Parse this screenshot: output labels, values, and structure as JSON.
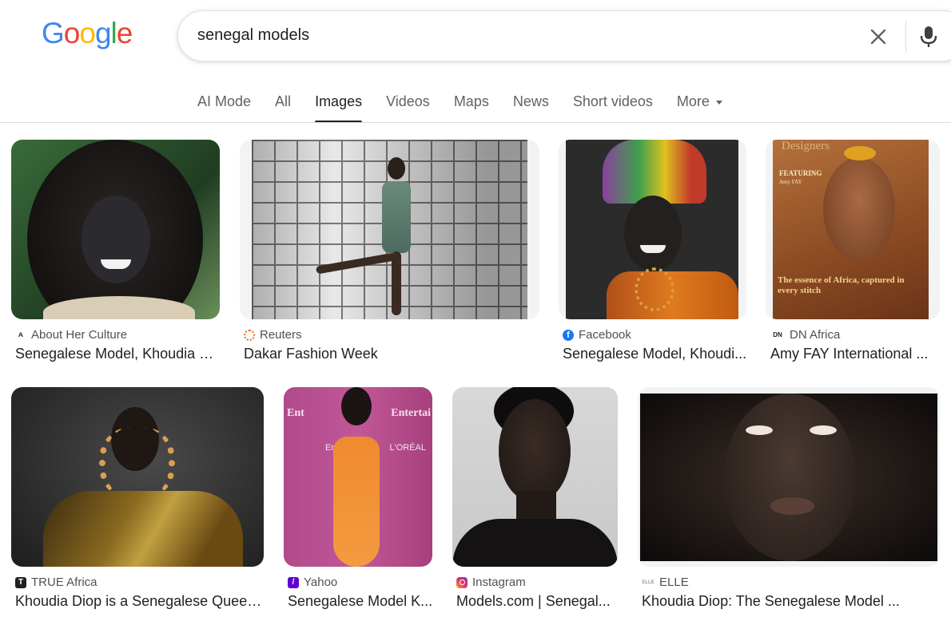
{
  "logo": {
    "text": "Google"
  },
  "search": {
    "query": "senegal models"
  },
  "tabs": [
    {
      "label": "AI Mode"
    },
    {
      "label": "All"
    },
    {
      "label": "Images"
    },
    {
      "label": "Videos"
    },
    {
      "label": "Maps"
    },
    {
      "label": "News"
    },
    {
      "label": "Short videos"
    },
    {
      "label": "More"
    }
  ],
  "results": [
    {
      "source": "About Her Culture",
      "title": "Senegalese Model, Khoudia D..."
    },
    {
      "source": "Reuters",
      "title": "Dakar Fashion Week"
    },
    {
      "source": "Facebook",
      "title": "Senegalese Model, Khoudi..."
    },
    {
      "source": "DN Africa",
      "title": "Amy FAY International ..."
    },
    {
      "source": "TRUE Africa",
      "title": "Khoudia Diop is a Senegalese Queen..."
    },
    {
      "source": "Yahoo",
      "title": "Senegalese Model K..."
    },
    {
      "source": "Instagram",
      "title": "Models.com | Senegal..."
    },
    {
      "source": "ELLE",
      "title": "Khoudia Diop: The Senegalese Model ..."
    }
  ],
  "magazine": {
    "masthead": "Designers",
    "featuring": "FEATURING",
    "name": "Amy FAY",
    "tagline": "The essence of Africa, captured in every stitch"
  },
  "colors": {
    "text": "#202124",
    "muted": "#5f6368",
    "border": "#dfe1e5"
  }
}
